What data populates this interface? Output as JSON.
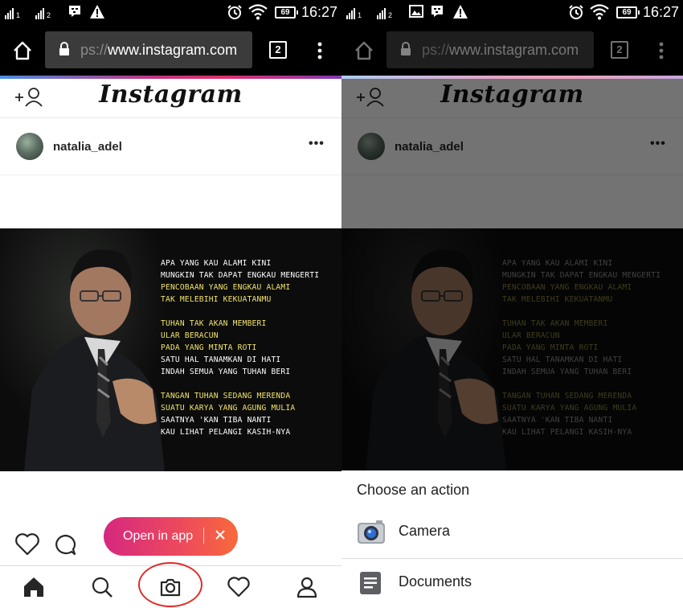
{
  "status_bar": {
    "sim1_number": "1",
    "sim2_number": "2",
    "battery_level": "69",
    "time": "16:27"
  },
  "browser": {
    "url_prefix": "ps://",
    "url_domain": "www.instagram.com",
    "tab_count": "2"
  },
  "instagram": {
    "logo": "Instagram",
    "post": {
      "username": "natalia_adel",
      "more_label": "•••",
      "poem_lines": [
        {
          "text": "APA YANG KAU ALAMI KINI",
          "color": "white"
        },
        {
          "text": "MUNGKIN TAK DAPAT ENGKAU MENGERTI",
          "color": "white"
        },
        {
          "text": "PENCOBAAN YANG ENGKAU ALAMI",
          "color": "yellow"
        },
        {
          "text": "TAK MELEBIHI KEKUATANMU",
          "color": "yellow"
        },
        {
          "text": "",
          "color": "gap"
        },
        {
          "text": "TUHAN TAK AKAN MEMBERI",
          "color": "yellow"
        },
        {
          "text": "ULAR BERACUN",
          "color": "yellow"
        },
        {
          "text": "PADA YANG MINTA ROTI",
          "color": "yellow"
        },
        {
          "text": "SATU HAL TANAMKAN DI HATI",
          "color": "white"
        },
        {
          "text": "INDAH SEMUA YANG TUHAN BERI",
          "color": "white"
        },
        {
          "text": "",
          "color": "gap"
        },
        {
          "text": "TANGAN TUHAN SEDANG MERENDA",
          "color": "yellow"
        },
        {
          "text": "SUATU KARYA YANG AGUNG MULIA",
          "color": "yellow"
        },
        {
          "text": "SAATNYA 'KAN TIBA NANTI",
          "color": "white"
        },
        {
          "text": "KAU LIHAT PELANGI KASIH-NYA",
          "color": "white"
        }
      ]
    },
    "open_in_app": "Open in app"
  },
  "chooser": {
    "title": "Choose an action",
    "items": [
      {
        "label": "Camera",
        "icon": "camera-app-icon"
      },
      {
        "label": "Documents",
        "icon": "documents-app-icon"
      }
    ]
  },
  "colors": {
    "open_in_app_gradient_start": "#d6287f",
    "open_in_app_gradient_end": "#f76a3a",
    "highlight_circle": "#e12b2b"
  }
}
